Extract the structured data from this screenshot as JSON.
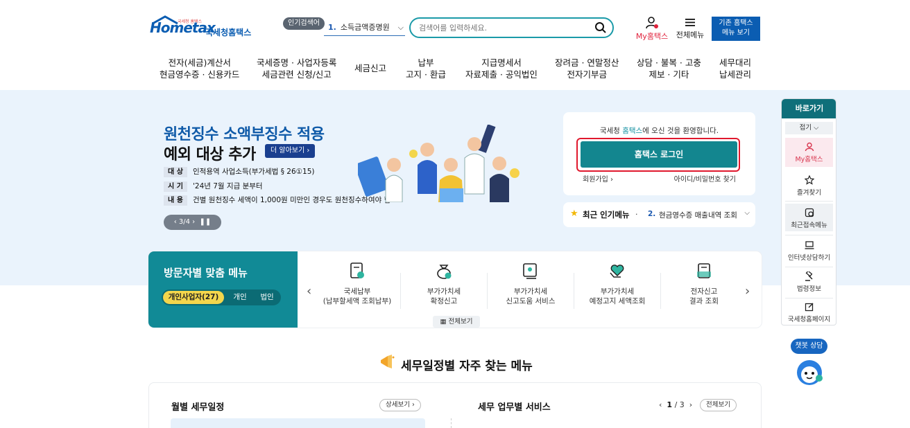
{
  "header": {
    "logo_main": "Hometax",
    "logo_small": "국세청 홈택스",
    "logo_kor": "국세청홈택스",
    "popular_badge": "인기검색어",
    "popular_num": "1.",
    "popular_term": "소득금액증명원",
    "search_placeholder": "검색어를 입력하세요.",
    "my_hometax": "My홈택스",
    "all_menu": "전체메뉴",
    "legacy_line1": "기존 홈택스",
    "legacy_line2": "메뉴 보기"
  },
  "gnb": [
    {
      "l1": "전자(세금)계산서",
      "l2": "현금영수증 · 신용카드"
    },
    {
      "l1": "국세증명 · 사업자등록",
      "l2": "세금관련 신청/신고"
    },
    {
      "l1": "세금신고",
      "l2": ""
    },
    {
      "l1": "납부",
      "l2": "고지 · 환급"
    },
    {
      "l1": "지급명세서",
      "l2": "자료제출 · 공익법인"
    },
    {
      "l1": "장려금 · 연말정산",
      "l2": "전자기부금"
    },
    {
      "l1": "상담 · 불복 · 고충",
      "l2": "제보 · 기타"
    },
    {
      "l1": "세무대리",
      "l2": "납세관리"
    }
  ],
  "banner": {
    "title1": "원천징수 소액부징수 적용",
    "title2": "예외 대상 추가",
    "more": "더 알아보기",
    "rows": [
      {
        "label": "대 상",
        "text": "인적용역 사업소득(부가세법 § 26①15)"
      },
      {
        "label": "시 기",
        "text": "'24년 7월 지급 분부터"
      },
      {
        "label": "내 용",
        "text": "건별 원천징수 세액이 1,000원 미만인 경우도 원천징수하여야 함"
      }
    ],
    "pager": "3/4"
  },
  "login": {
    "welcome_pre": "국세청 ",
    "welcome_hl": "홈택스",
    "welcome_post": "에 오신 것을 환영합니다.",
    "button": "홈택스 로그인",
    "join": "회원가입",
    "find": "아이디/비밀번호 찾기"
  },
  "hot_menu": {
    "title": "최근 인기메뉴",
    "num": "2.",
    "text": "현금영수증 매출내역 조회"
  },
  "visitor": {
    "title": "방문자별 맞춤 메뉴",
    "tabs": [
      "개인사업자(27)",
      "개인",
      "법인"
    ],
    "items": [
      {
        "l1": "국세납부",
        "l2": "(납부할세액 조회납부)",
        "icon": "tax-payment-icon"
      },
      {
        "l1": "부가가치세",
        "l2": "확정신고",
        "icon": "vat-bag-icon"
      },
      {
        "l1": "부가가치세",
        "l2": "신고도움 서비스",
        "icon": "vat-help-icon"
      },
      {
        "l1": "부가가치세",
        "l2": "예정고지 세액조회",
        "icon": "vat-heart-icon"
      },
      {
        "l1": "전자신고",
        "l2": "결과 조회",
        "icon": "e-filing-icon"
      }
    ],
    "view_all": "전체보기"
  },
  "schedule": {
    "section_title": "세무일정별 자주 찾는 메뉴",
    "month_title": "월별 세무일정",
    "detail": "상세보기",
    "biz_title": "세무 업무별 서비스",
    "biz_page": "1",
    "biz_total": "/ 3",
    "biz_all": "전체보기"
  },
  "quick": {
    "title": "바로가기",
    "fold": "접기",
    "items": [
      "My홈택스",
      "즐겨찾기",
      "최근접속메뉴",
      "인터넷상담하기",
      "법령정보",
      "국세청홈페이지"
    ]
  },
  "chatbot": {
    "label": "챗봇 상담"
  },
  "colors": {
    "primary_blue": "#0b5db2",
    "teal": "#13868f",
    "highlight_red": "#e0182d",
    "banner_bg": "#eaf3fc",
    "tab_yellow": "#f3d64c"
  }
}
